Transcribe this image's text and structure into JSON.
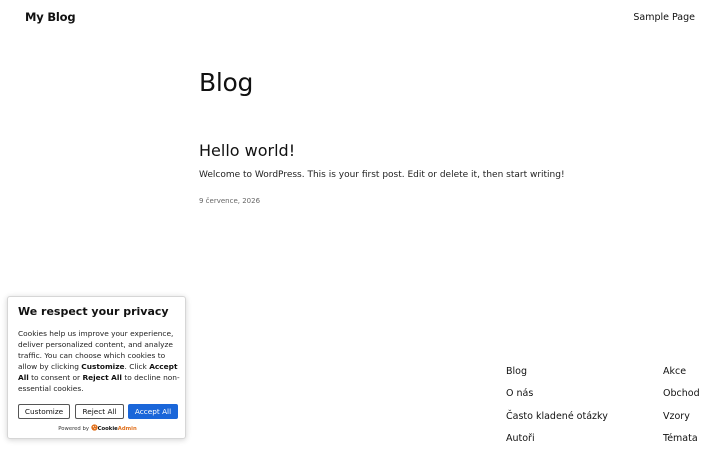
{
  "header": {
    "site_title": "My Blog",
    "nav": [
      "Sample Page"
    ]
  },
  "main": {
    "heading": "Blog",
    "posts": [
      {
        "title": "Hello world!",
        "excerpt": "Welcome to WordPress. This is your first post. Edit or delete it, then start writing!",
        "date": "9 července, 2026"
      }
    ]
  },
  "footer": {
    "col1": [
      "Blog",
      "O nás",
      "Často kladené otázky",
      "Autoři"
    ],
    "col2": [
      "Akce",
      "Obchod",
      "Vzory",
      "Témata"
    ]
  },
  "cookie_banner": {
    "title": "We respect your privacy",
    "text_1": "Cookies help us improve your experience, deliver personalized content, and analyze traffic. You can choose which cookies to allow by clicking ",
    "text_customize": "Customize",
    "text_2": ". Click ",
    "text_accept": "Accept All",
    "text_3": " to consent or ",
    "text_reject": "Reject All",
    "text_4": " to decline non-essential cookies.",
    "buttons": {
      "customize": "Customize",
      "reject": "Reject All",
      "accept": "Accept All"
    },
    "powered_by": "Powered by",
    "brand_part1": "Cookie",
    "brand_part2": "Admin",
    "accent_color": "#1a66d9",
    "brand_color": "#e0701c",
    "logo_icon": "cookie-icon"
  }
}
